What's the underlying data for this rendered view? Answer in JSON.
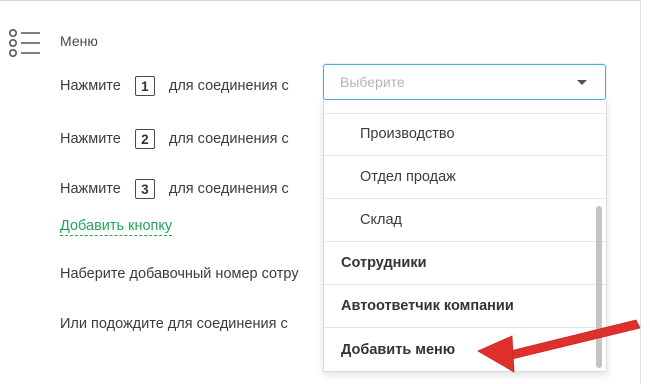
{
  "menu": {
    "title": "Меню",
    "icon": "list-icon"
  },
  "rows": [
    {
      "prefix": "Нажмите",
      "key": "1",
      "suffix": "для соединения с"
    },
    {
      "prefix": "Нажмите",
      "key": "2",
      "suffix": "для соединения с"
    },
    {
      "prefix": "Нажмите",
      "key": "3",
      "suffix": "для соединения с"
    }
  ],
  "add_button_link": "Добавить кнопку",
  "extension_text": "Наберите добавочный номер сотру",
  "wait_text": "Или подождите для соединения с",
  "select": {
    "placeholder": "Выберите",
    "icon": "caret-down-icon"
  },
  "dropdown": {
    "items": [
      {
        "label": "Производство",
        "type": "sub"
      },
      {
        "label": "Отдел продаж",
        "type": "sub"
      },
      {
        "label": "Склад",
        "type": "sub"
      },
      {
        "label": "Сотрудники",
        "type": "group"
      },
      {
        "label": "Автоответчик компании",
        "type": "group"
      },
      {
        "label": "Добавить меню",
        "type": "group"
      }
    ]
  },
  "colors": {
    "link": "#27a25a",
    "select_border": "#45b0e6",
    "arrow": "#e53935"
  }
}
